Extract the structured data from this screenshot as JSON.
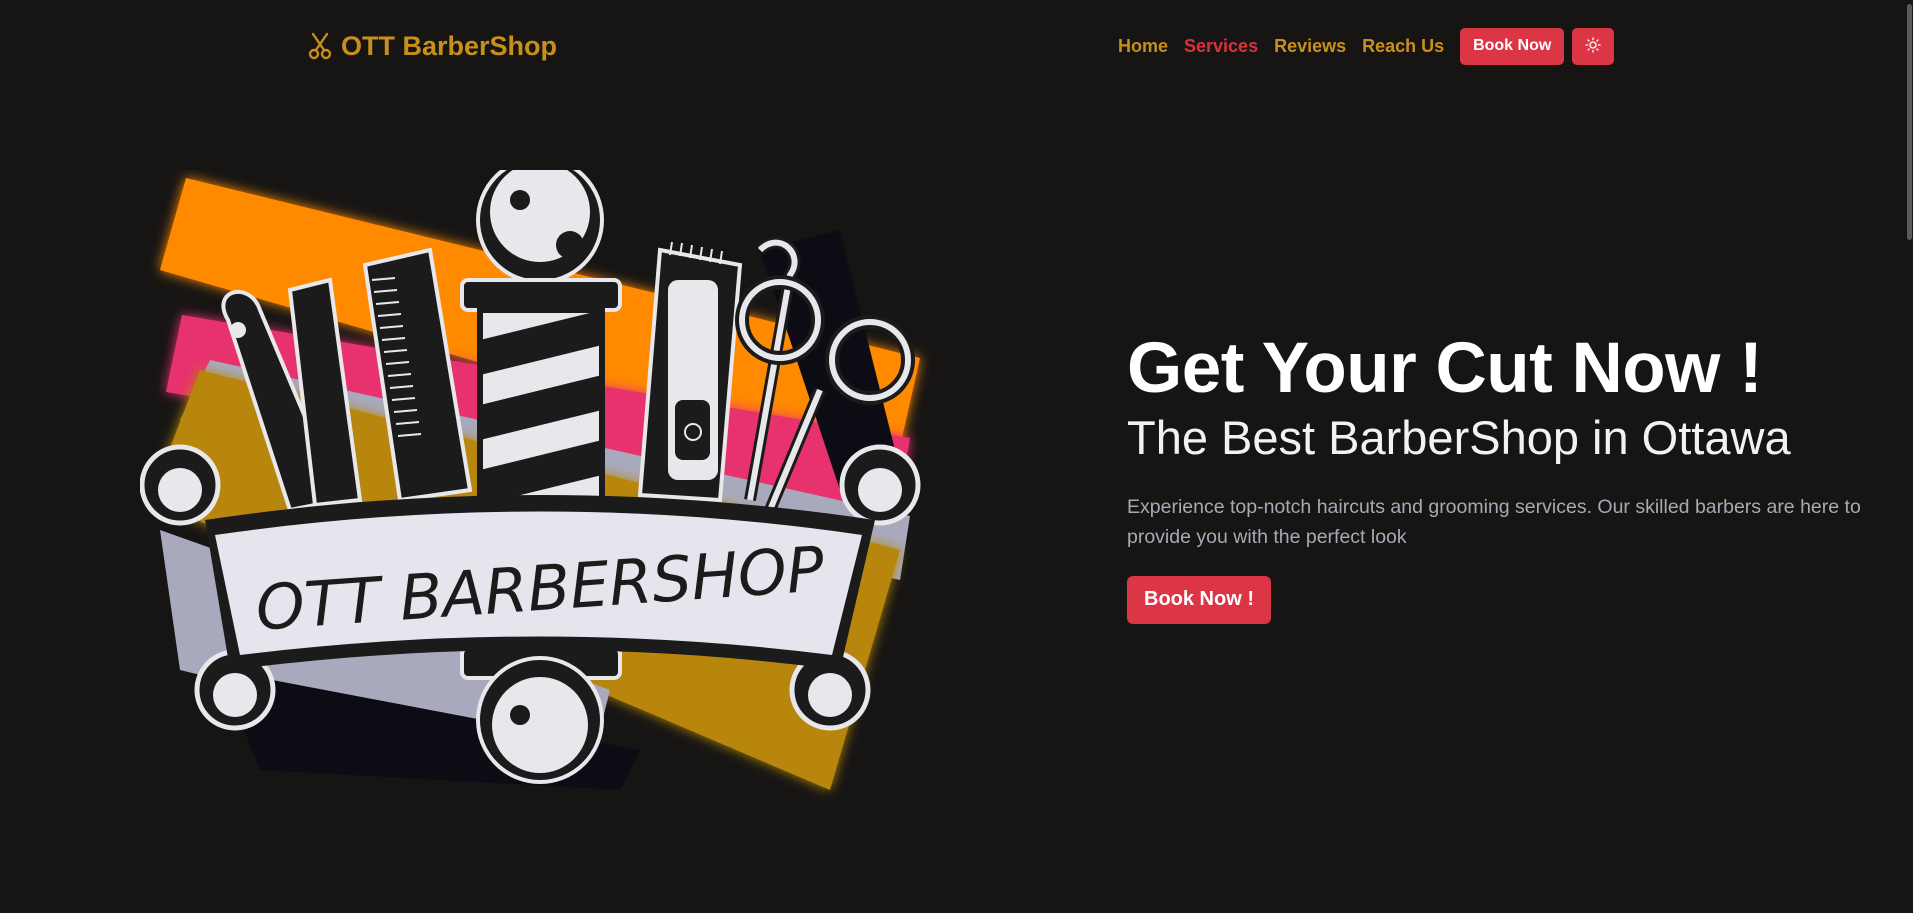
{
  "navbar": {
    "brand_icon": "scissors-icon",
    "brand_label": "OTT BarberShop",
    "links": [
      {
        "label": "Home",
        "active": false
      },
      {
        "label": "Services",
        "active": true
      },
      {
        "label": "Reviews",
        "active": false
      },
      {
        "label": "Reach Us",
        "active": false
      }
    ],
    "book_button_label": "Book Now",
    "theme_toggle_icon": "sun-icon"
  },
  "hero": {
    "logo_text": "OTT BARBERSHOP",
    "title": "Get Your Cut Now !",
    "subtitle": "The Best BarberShop in Ottawa",
    "description": "Experience top-notch haircuts and grooming services. Our skilled barbers are here to provide you with the perfect look",
    "cta_label": "Book Now !"
  },
  "colors": {
    "background": "#161514",
    "brand_gold": "#c8901a",
    "accent_red": "#dc3545",
    "active_link": "#d8323f",
    "muted_text": "#a7a9b6",
    "logo_orange": "#ff8a00",
    "logo_pink": "#e8336e",
    "logo_mustard": "#b8860b",
    "logo_lavender": "#a8a9bd"
  }
}
